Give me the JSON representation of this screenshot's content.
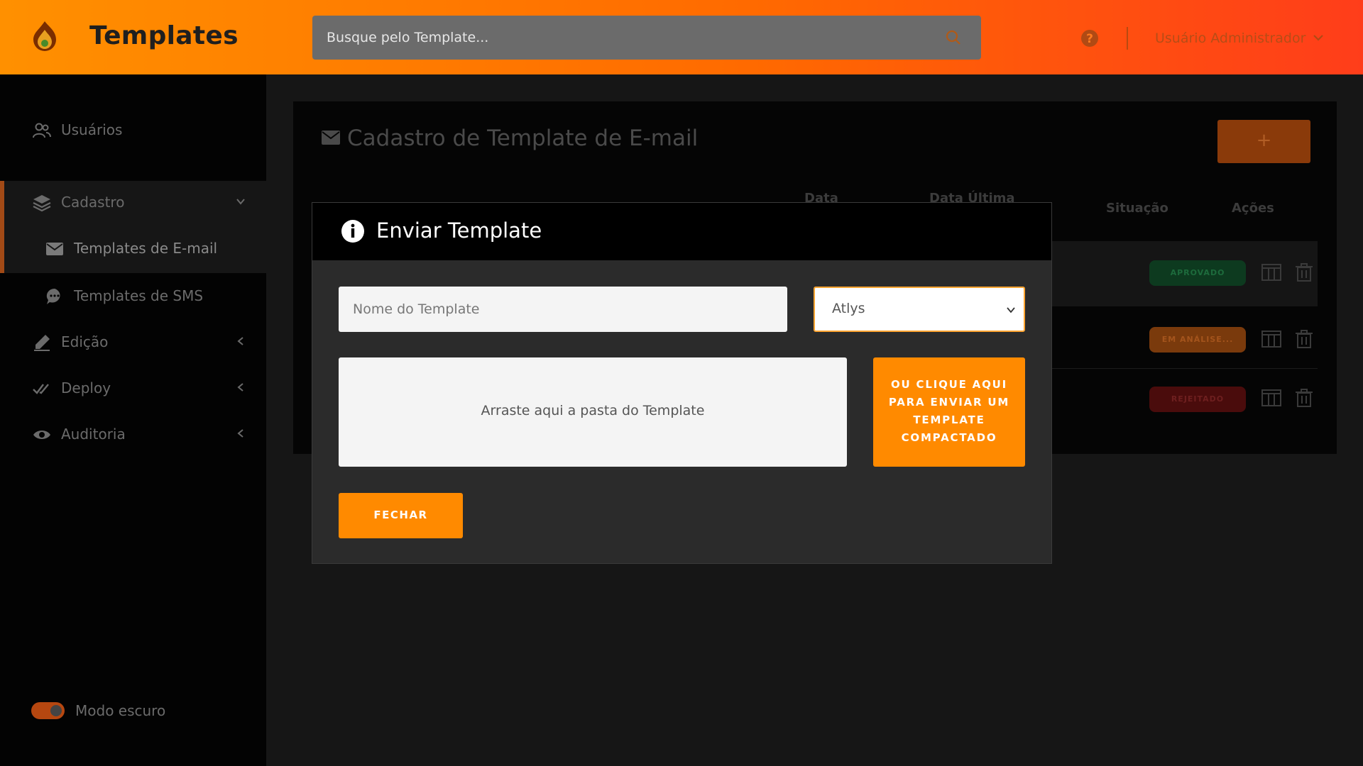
{
  "header": {
    "app_title": "Templates",
    "search_placeholder": "Busque pelo Template...",
    "user_name": "Usuário Administrador"
  },
  "sidebar": {
    "items": [
      {
        "label": "Usuários",
        "icon": "users-icon"
      },
      {
        "label": "Cadastro",
        "icon": "layers-icon"
      },
      {
        "label": "Templates de E-mail",
        "icon": "envelope-icon"
      },
      {
        "label": "Templates de SMS",
        "icon": "chat-icon"
      },
      {
        "label": "Edição",
        "icon": "pen-icon"
      },
      {
        "label": "Deploy",
        "icon": "double-check-icon"
      },
      {
        "label": "Auditoria",
        "icon": "eye-icon"
      }
    ],
    "dark_mode_label": "Modo escuro",
    "dark_mode_on": true
  },
  "main": {
    "card_title": "Cadastro de Template de E-mail",
    "add_button": "+",
    "columns": [
      "Data",
      "Data Última",
      "Situação",
      "Ações"
    ],
    "rows": [
      {
        "status": "APROVADO"
      },
      {
        "status": "EM ANÁLISE..."
      },
      {
        "status": "REJEITADO"
      }
    ]
  },
  "modal": {
    "title": "Enviar Template",
    "name_placeholder": "Nome do Template",
    "select_value": "Atlys",
    "dropzone_text": "Arraste aqui a pasta do Template",
    "upload_button": "OU CLIQUE AQUI PARA ENVIAR UM TEMPLATE COMPACTADO",
    "close_button": "FECHAR"
  },
  "colors": {
    "accent": "#ff8a00",
    "header_gradient_start": "#ff9000",
    "header_gradient_end": "#ff3d1a"
  }
}
